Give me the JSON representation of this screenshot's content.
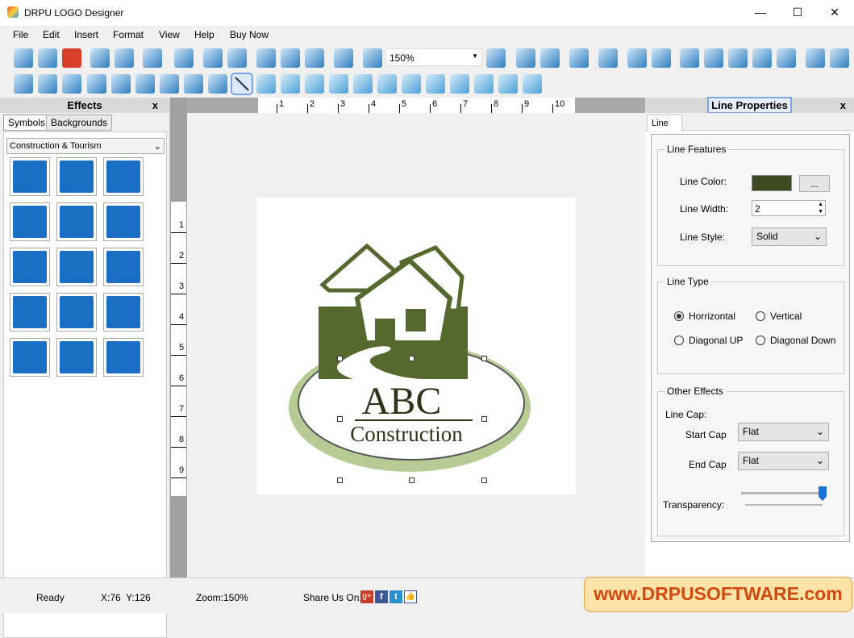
{
  "app": {
    "title": "DRPU LOGO Designer"
  },
  "menu": [
    "File",
    "Edit",
    "Insert",
    "Format",
    "View",
    "Help",
    "Buy Now"
  ],
  "toolbar": {
    "zoom_value": "150%"
  },
  "effects": {
    "title": "Effects",
    "close": "x",
    "tabs": [
      "Symbols",
      "Backgrounds"
    ],
    "category": "Construction & Tourism",
    "symbols": [
      "crane-building",
      "house-road",
      "city",
      "windmill",
      "desert-cactus",
      "factory",
      "bank",
      "house-road-2",
      "stadium",
      "airplane",
      "airplane-2",
      "rocket",
      "sailboat",
      "sailboat-2",
      "train"
    ]
  },
  "ruler": {
    "top": [
      "1",
      "2",
      "3",
      "4",
      "5",
      "6",
      "7",
      "8",
      "9",
      "10"
    ],
    "left": [
      "1",
      "2",
      "3",
      "4",
      "5",
      "6",
      "7",
      "8",
      "9"
    ]
  },
  "logo": {
    "line1": "ABC",
    "line2": "Construction",
    "colors": {
      "house": "#55692e",
      "ellipse": "#b7cc95"
    }
  },
  "props": {
    "title": "Line Properties",
    "close": "x",
    "tab": "Line",
    "features": {
      "title": "Line Features",
      "color_label": "Line Color:",
      "color": "#3d4a1f",
      "browse": "...",
      "width_label": "Line Width:",
      "width": "2",
      "style_label": "Line Style:",
      "style": "Solid"
    },
    "type": {
      "title": "Line Type",
      "options": [
        "Horrizontal",
        "Vertical",
        "Diagonal UP",
        "Diagonal Down"
      ],
      "selected": "Horrizontal"
    },
    "other": {
      "title": "Other Effects",
      "cap_label": "Line Cap:",
      "start_label": "Start Cap",
      "start": "Flat",
      "end_label": "End Cap",
      "end": "Flat",
      "transparency_label": "Transparency:",
      "transparency": 1.0
    }
  },
  "status": {
    "ready": "Ready",
    "coords": "X:76  Y:126",
    "zoom": "Zoom:150%",
    "share": "Share Us On:",
    "banner": "www.DRPUSOFTWARE.com"
  }
}
